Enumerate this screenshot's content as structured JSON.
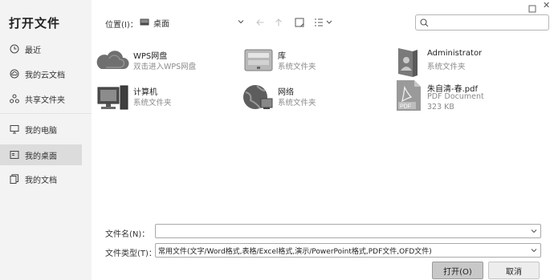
{
  "dialog": {
    "title": "打开文件"
  },
  "sidebar": {
    "items": [
      {
        "label": "最近",
        "icon": "clock-icon"
      },
      {
        "label": "我的云文档",
        "icon": "cloud-icon"
      },
      {
        "label": "共享文件夹",
        "icon": "share-icon"
      },
      {
        "label": "我的电脑",
        "icon": "monitor-icon"
      },
      {
        "label": "我的桌面",
        "icon": "desktop-icon",
        "selected": true
      },
      {
        "label": "我的文档",
        "icon": "documents-icon"
      }
    ]
  },
  "toolbar": {
    "location_label": "位置(I)：",
    "location_value": "桌面",
    "search_placeholder": ""
  },
  "files": [
    {
      "name": "WPS网盘",
      "sub": "双击进入WPS网盘",
      "icon": "cloud-drive-icon"
    },
    {
      "name": "库",
      "sub": "系统文件夹",
      "icon": "library-icon"
    },
    {
      "name": "Administrator",
      "sub": "系统文件夹",
      "icon": "user-folder-icon"
    },
    {
      "name": "计算机",
      "sub": "系统文件夹",
      "icon": "computer-icon"
    },
    {
      "name": "网络",
      "sub": "系统文件夹",
      "icon": "network-icon"
    },
    {
      "name": "朱自清-春.pdf",
      "sub": "PDF Document",
      "size": "323 KB",
      "icon": "pdf-file-icon",
      "pdf_tag": "PDF"
    }
  ],
  "bottom": {
    "filename_label": "文件名(N)：",
    "filename_value": "",
    "filetype_label": "文件类型(T)：",
    "filetype_value": "常用文件(文字/Word格式,表格/Excel格式,演示/PowerPoint格式,PDF文件,OFD文件)",
    "open_label": "打开(O)",
    "cancel_label": "取消"
  },
  "colors": {
    "sidebar_bg": "#f3f3f3",
    "selected_bg": "#dcdcdc",
    "open_button_bg": "#c8c8c8"
  }
}
